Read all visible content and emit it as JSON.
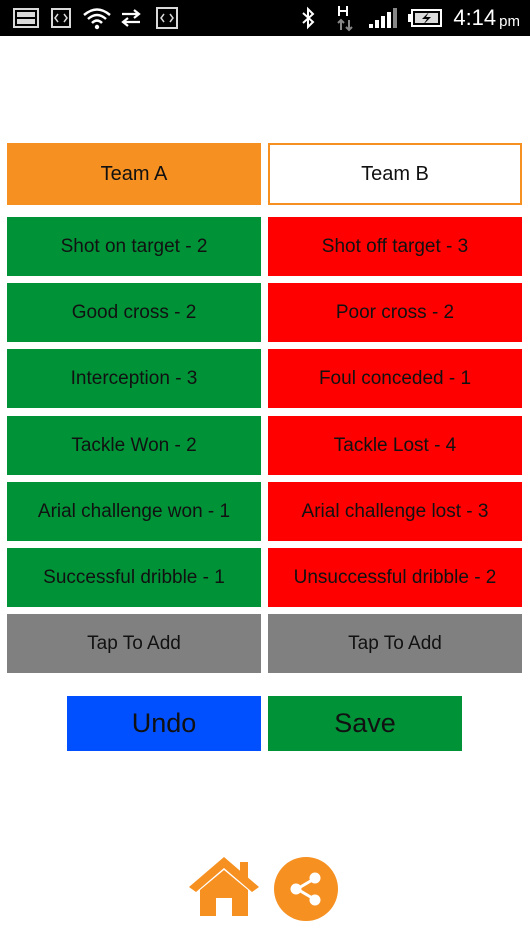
{
  "status_bar": {
    "time": "4:14",
    "ampm": "pm",
    "icons": [
      "image-icon",
      "code-icon",
      "wifi-icon",
      "sync-icon",
      "code-icon",
      "bluetooth-icon",
      "data-h-icon",
      "signal-icon",
      "battery-charging-icon"
    ]
  },
  "teams": {
    "team_a": "Team A",
    "team_b": "Team B"
  },
  "stats_a": [
    "Shot on target - 2",
    "Good cross - 2",
    "Interception - 3",
    "Tackle Won - 2",
    "Arial challenge won - 1",
    "Successful dribble - 1",
    "Tap To Add"
  ],
  "stats_b": [
    "Shot off target - 3",
    "Poor cross - 2",
    "Foul conceded - 1",
    "Tackle Lost - 4",
    "Arial challenge lost - 3",
    "Unsuccessful dribble - 2",
    "Tap To Add"
  ],
  "actions": {
    "undo": "Undo",
    "save": "Save"
  },
  "footer": {
    "icons": [
      "home-icon",
      "share-icon"
    ]
  },
  "colors": {
    "accent": "#f59021",
    "positive": "#009237",
    "negative": "#ff0000",
    "neutral": "#808080",
    "undo": "#0050ff"
  }
}
